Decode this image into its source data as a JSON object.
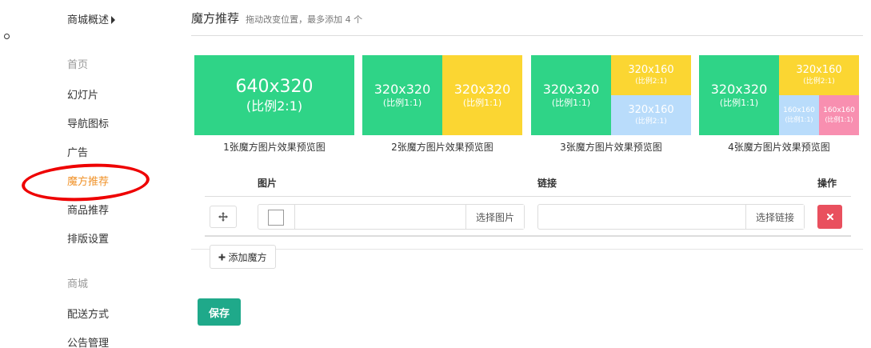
{
  "sidebar": {
    "items": [
      {
        "label": "商城概述",
        "kind": "link-arrow"
      },
      {
        "label": "首页",
        "kind": "group"
      },
      {
        "label": "幻灯片",
        "kind": "link"
      },
      {
        "label": "导航图标",
        "kind": "link"
      },
      {
        "label": "广告",
        "kind": "link"
      },
      {
        "label": "魔方推荐",
        "kind": "active"
      },
      {
        "label": "商品推荐",
        "kind": "link"
      },
      {
        "label": "排版设置",
        "kind": "link"
      },
      {
        "label": "商城",
        "kind": "group"
      },
      {
        "label": "配送方式",
        "kind": "link"
      },
      {
        "label": "公告管理",
        "kind": "link"
      }
    ],
    "active_color": "#f0932b",
    "highlight_color": "#ee0000"
  },
  "header": {
    "title": "魔方推荐",
    "subtitle": "拖动改变位置，最多添加 4 个"
  },
  "previews": [
    {
      "caption": "1张魔方图片效果预览图",
      "blocks": [
        {
          "size": "640x320",
          "ratio": "(比例2:1)",
          "color": "#2fd487"
        }
      ]
    },
    {
      "caption": "2张魔方图片效果预览图",
      "blocks": [
        {
          "size": "320x320",
          "ratio": "(比例1:1)",
          "color": "#2fd487"
        },
        {
          "size": "320x320",
          "ratio": "(比例1:1)",
          "color": "#fbd632"
        }
      ]
    },
    {
      "caption": "3张魔方图片效果预览图",
      "blocks": [
        {
          "size": "320x320",
          "ratio": "(比例1:1)",
          "color": "#2fd487"
        },
        {
          "size": "320x160",
          "ratio": "(比例2:1)",
          "color": "#fbd632"
        },
        {
          "size": "320x160",
          "ratio": "(比例2:1)",
          "color": "#b9dcfb"
        }
      ]
    },
    {
      "caption": "4张魔方图片效果预览图",
      "blocks": [
        {
          "size": "320x320",
          "ratio": "(比例1:1)",
          "color": "#2fd487"
        },
        {
          "size": "320x160",
          "ratio": "(比例2:1)",
          "color": "#fbd632"
        },
        {
          "size": "160x160",
          "ratio": "(比例1:1)",
          "color": "#b9dcfb"
        },
        {
          "size": "160x160",
          "ratio": "(比例1:1)",
          "color": "#f88fb0"
        }
      ]
    }
  ],
  "table": {
    "headers": {
      "image": "图片",
      "link": "链接",
      "action": "操作"
    },
    "rows": [
      {
        "image_button": "选择图片",
        "link_value": "",
        "link_button": "选择链接",
        "delete_icon": "times-icon"
      }
    ]
  },
  "buttons": {
    "add": "添加魔方",
    "add_icon": "plus-icon",
    "move_icon": "arrows-move-icon",
    "save": "保存"
  },
  "colors": {
    "save": "#1fa98a",
    "delete": "#e9505e"
  }
}
